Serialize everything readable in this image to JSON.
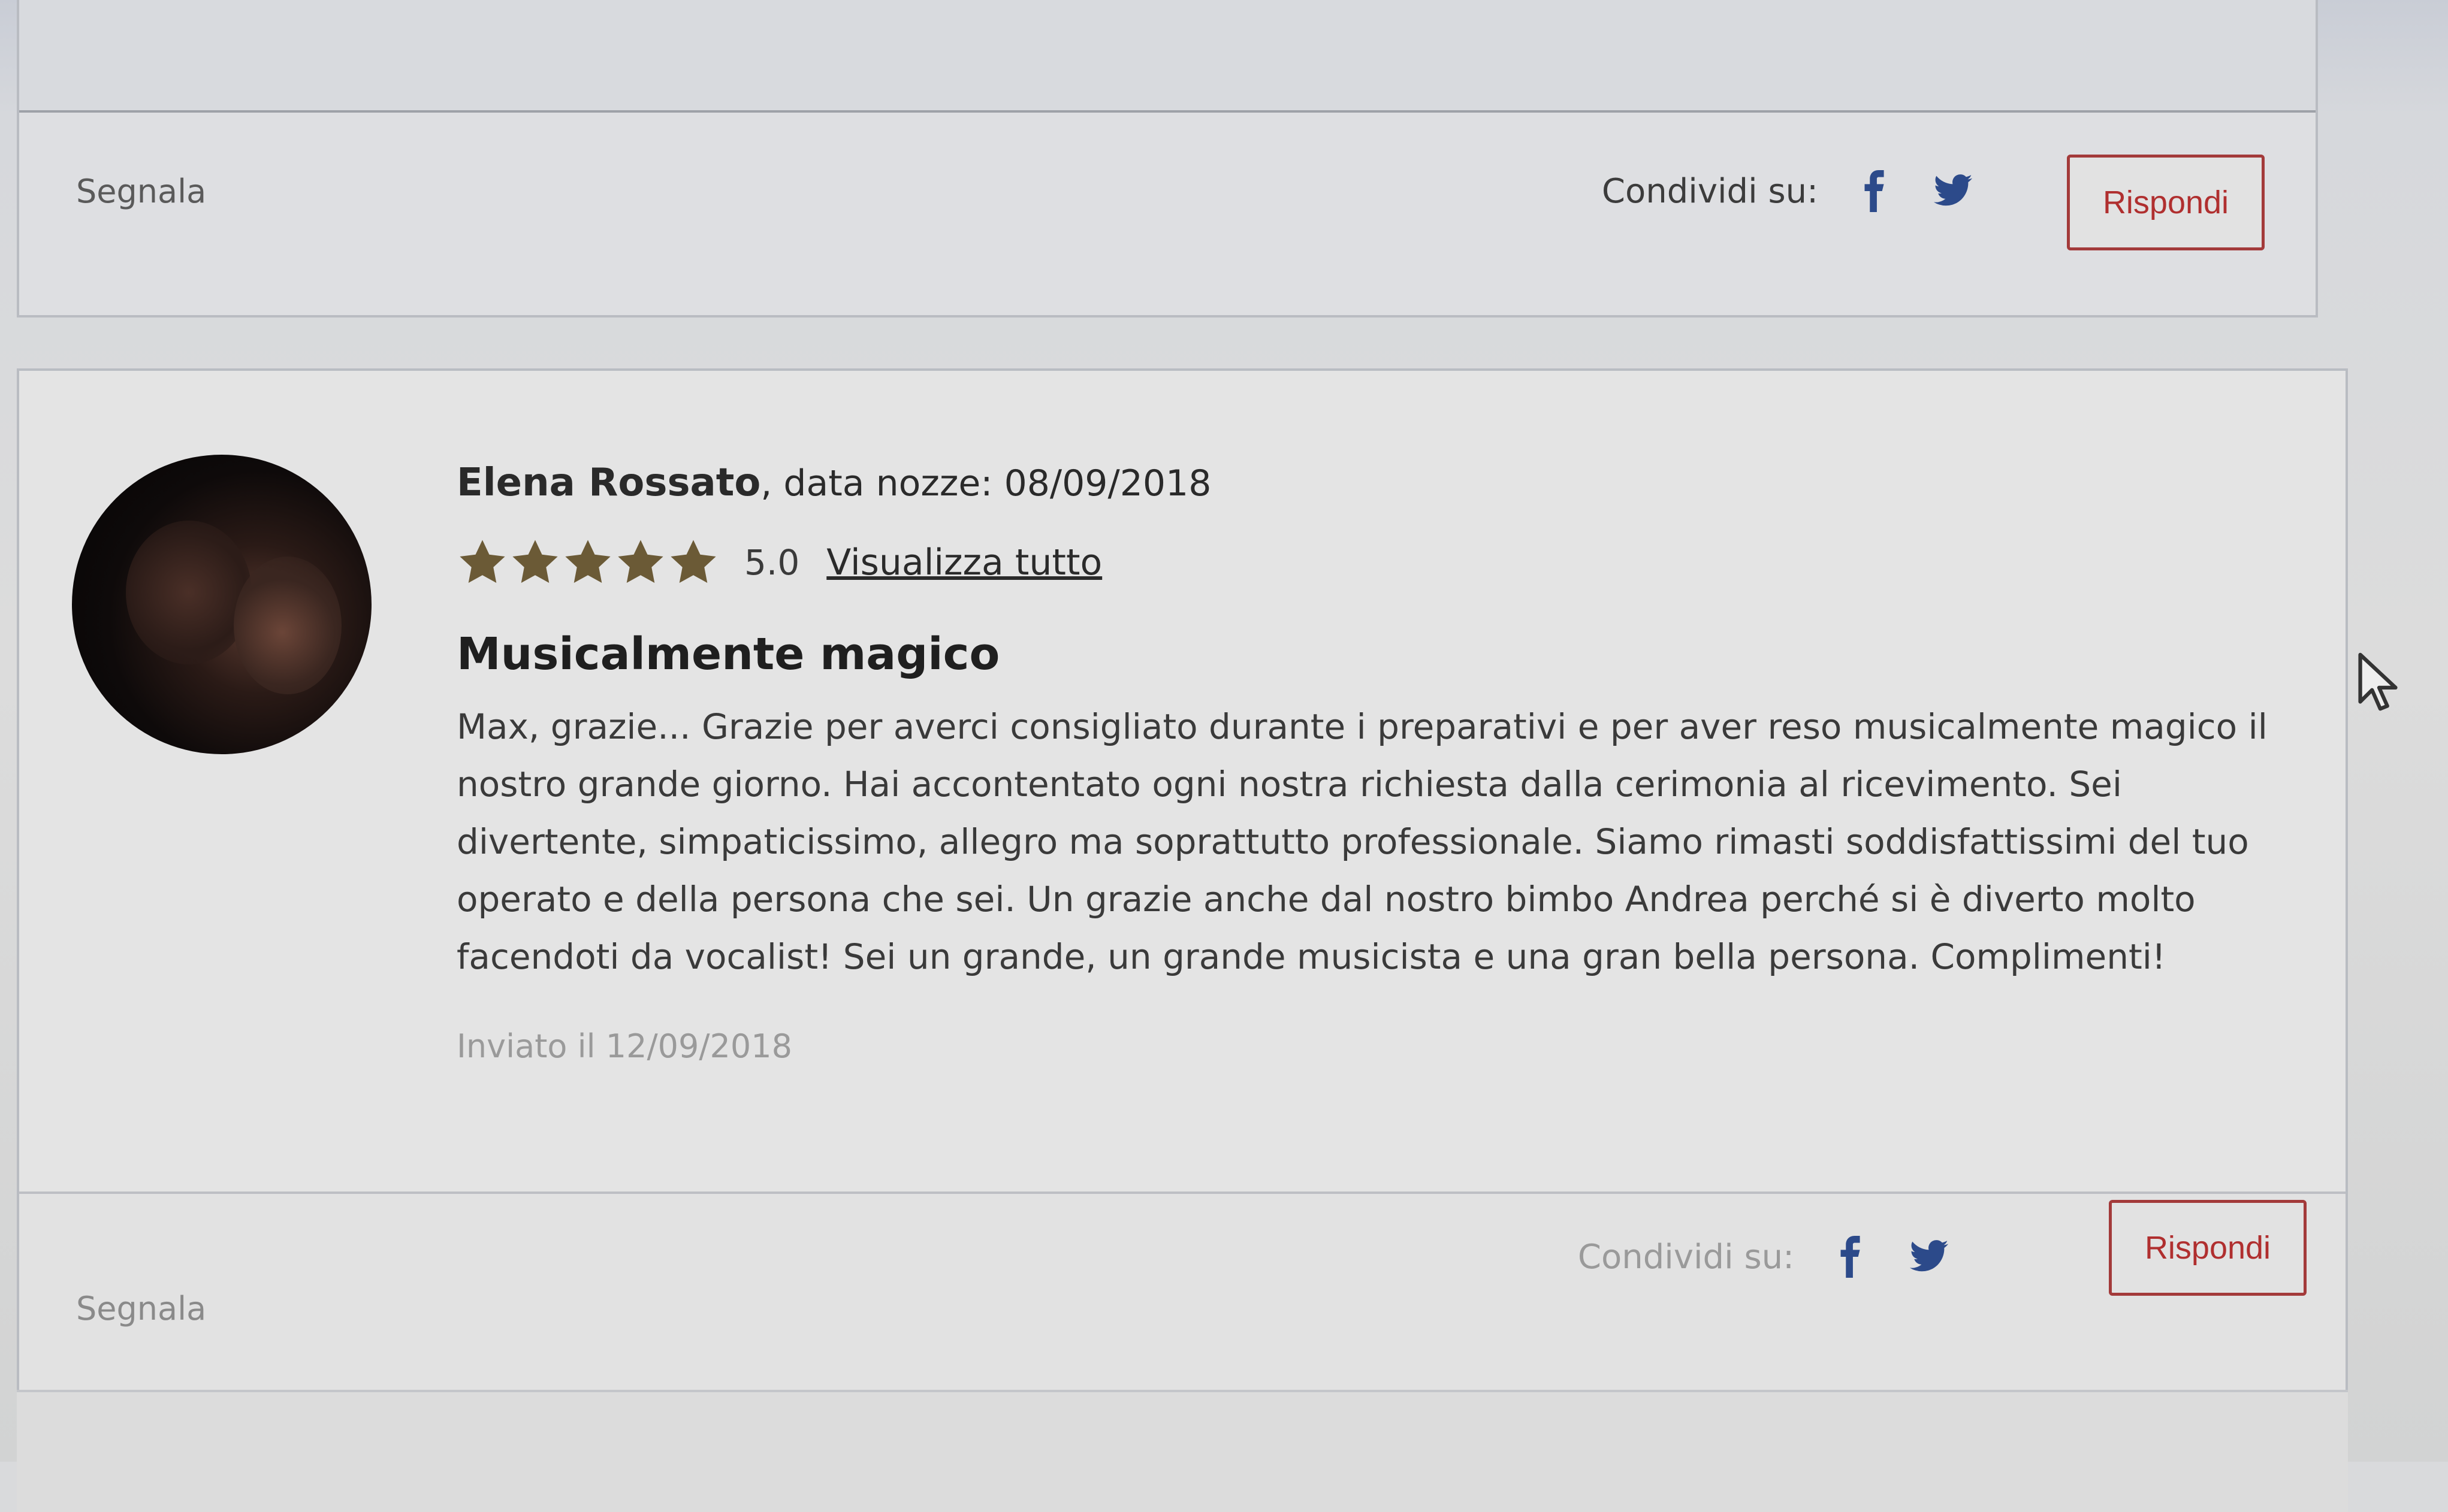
{
  "previous_review": {
    "report_label": "Segnala",
    "share_label": "Condividi su:",
    "reply_label": "Rispondi"
  },
  "review": {
    "author": "Elena Rossato",
    "wedding_date": ", data nozze: 08/09/2018",
    "rating": 5,
    "rating_display": "5.0",
    "view_all_label": "Visualizza tutto",
    "title": "Musicalmente magico",
    "body": "Max, grazie... Grazie per averci consigliato durante i preparativi e per aver reso musicalmente magico il nostro grande giorno. Hai accontentato ogni nostra richiesta dalla cerimonia al ricevimento. Sei divertente, simpaticissimo, allegro ma soprattutto professionale. Siamo rimasti soddisfattissimi del tuo operato e della persona che sei. Un grazie anche dal nostro bimbo Andrea perché si è diverto molto facendoti da vocalist! Sei un grande, un grande musicista e una gran bella persona. Complimenti!",
    "sent_date": "Inviato il 12/09/2018",
    "report_label": "Segnala",
    "share_label": "Condividi su:",
    "reply_label": "Rispondi"
  },
  "icons": {
    "facebook": "facebook-icon",
    "twitter": "twitter-icon",
    "star": "star-icon"
  },
  "colors": {
    "star": "#6b5a36",
    "reply_border": "#a33a3a",
    "reply_text": "#b02f2f",
    "social_icon": "#2c4a8a"
  }
}
